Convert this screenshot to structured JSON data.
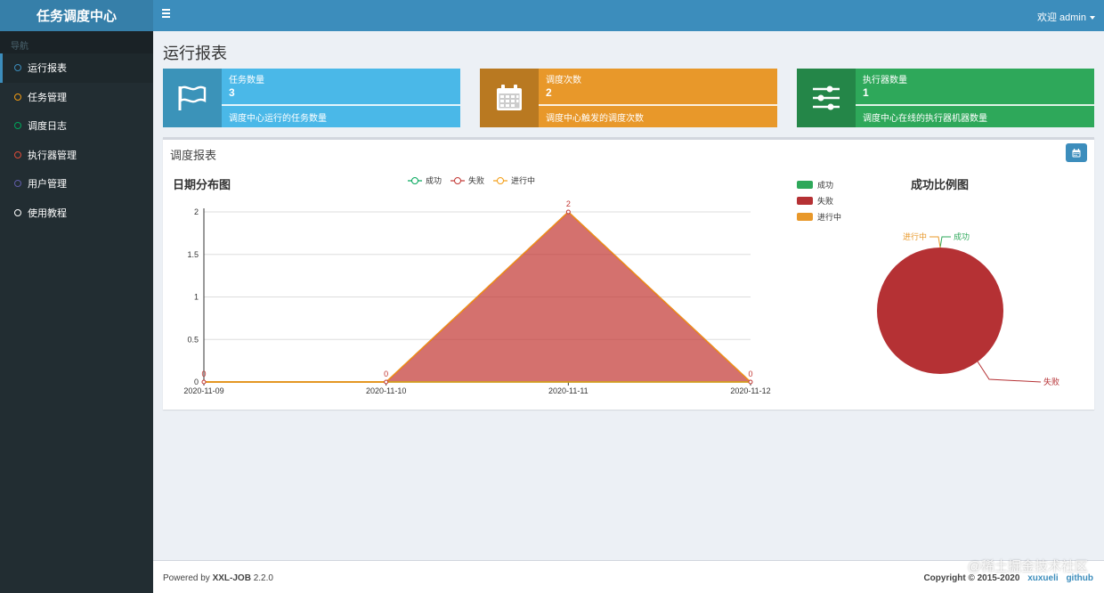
{
  "app": {
    "title": "任务调度中心"
  },
  "header": {
    "user_label": "欢迎 admin"
  },
  "sidebar": {
    "header": "导航",
    "items": [
      {
        "label": "运行报表",
        "color": "#3c8dbc"
      },
      {
        "label": "任务管理",
        "color": "#f39c12"
      },
      {
        "label": "调度日志",
        "color": "#00a65a"
      },
      {
        "label": "执行器管理",
        "color": "#dd4b39"
      },
      {
        "label": "用户管理",
        "color": "#605ca8"
      },
      {
        "label": "使用教程",
        "color": "#ffffff"
      }
    ]
  },
  "page": {
    "title": "运行报表"
  },
  "info_boxes": [
    {
      "label": "任务数量",
      "value": "3",
      "desc": "调度中心运行的任务数量",
      "color": "#4ab8e8",
      "icon": "flag-icon"
    },
    {
      "label": "调度次数",
      "value": "2",
      "desc": "调度中心触发的调度次数",
      "color": "#e8982a",
      "icon": "calendar-icon"
    },
    {
      "label": "执行器数量",
      "value": "1",
      "desc": "调度中心在线的执行器机器数量",
      "color": "#2ea85a",
      "icon": "sliders-icon"
    }
  ],
  "report": {
    "title": "调度报表"
  },
  "chart_data": [
    {
      "type": "area",
      "title": "日期分布图",
      "categories": [
        "2020-11-09",
        "2020-11-10",
        "2020-11-11",
        "2020-11-12"
      ],
      "series": [
        {
          "name": "成功",
          "values": [
            0,
            0,
            0,
            0
          ],
          "color": "#00a65a"
        },
        {
          "name": "失败",
          "values": [
            0,
            0,
            2,
            0
          ],
          "color": "#c23531"
        },
        {
          "name": "进行中",
          "values": [
            0,
            0,
            0,
            0
          ],
          "color": "#f39c12"
        }
      ],
      "data_labels": [
        "0",
        "0",
        "2",
        "0"
      ],
      "ylim": [
        0,
        2
      ],
      "yticks": [
        "0",
        "0.5",
        "1",
        "1.5",
        "2"
      ],
      "grid": true,
      "legend": "top-center"
    },
    {
      "type": "pie",
      "title": "成功比例图",
      "slices": [
        {
          "name": "成功",
          "value": 0,
          "color": "#2ea85a"
        },
        {
          "name": "失败",
          "value": 2,
          "color": "#b53134"
        },
        {
          "name": "进行中",
          "value": 0,
          "color": "#e8982a"
        }
      ],
      "legend": "top-left"
    }
  ],
  "footer": {
    "powered_prefix": "Powered by ",
    "product": "XXL-JOB",
    "version": " 2.2.0",
    "copyright": "Copyright © 2015-2020",
    "link1": "xuxueli",
    "link2": "github"
  },
  "watermark": "@稀土掘金技术社区"
}
